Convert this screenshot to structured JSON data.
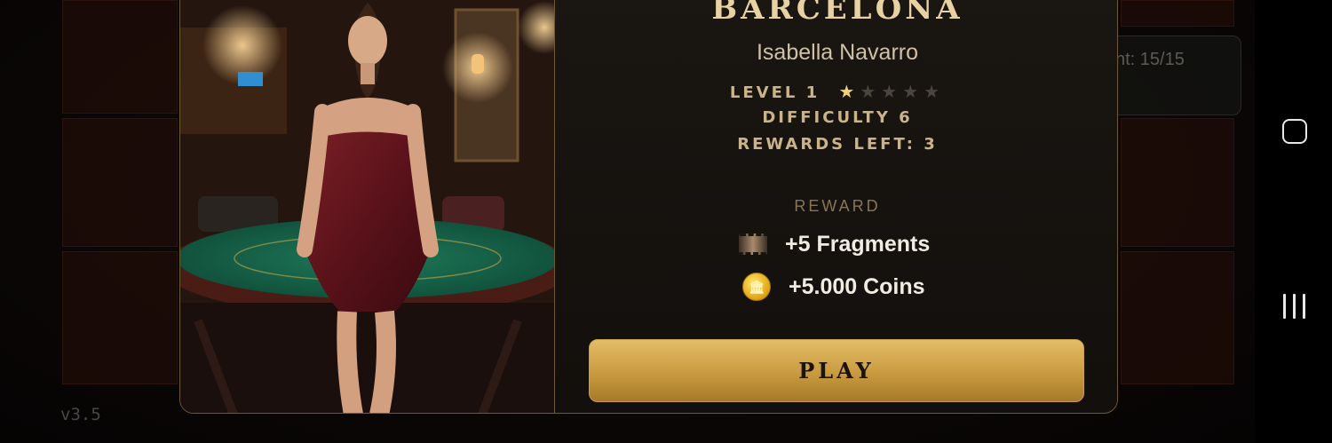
{
  "background": {
    "status_text": "nt: 15/15",
    "version": "v3.5"
  },
  "modal": {
    "location_title": "BARCELONA",
    "character_name": "Isabella Navarro",
    "level_label": "LEVEL 1",
    "level_stars": {
      "filled": 1,
      "total": 5
    },
    "difficulty": "DIFFICULTY 6",
    "rewards_left": "REWARDS LEFT: 3",
    "reward_heading": "REWARD",
    "rewards": [
      {
        "icon": "film-fragment-icon",
        "label": "+5 Fragments"
      },
      {
        "icon": "gold-coin-icon",
        "label": "+5.000 Coins"
      }
    ],
    "play_label": "PLAY"
  },
  "colors": {
    "accent_gold": "#c99a3e",
    "title_gold": "#e8d2a4",
    "star_filled": "#f2d27a",
    "star_empty": "#4a463e",
    "panel_bg": "#120f0c",
    "border_gold": "#6e5a32"
  },
  "system_nav": {
    "buttons": [
      "home-button",
      "recents-button"
    ]
  }
}
